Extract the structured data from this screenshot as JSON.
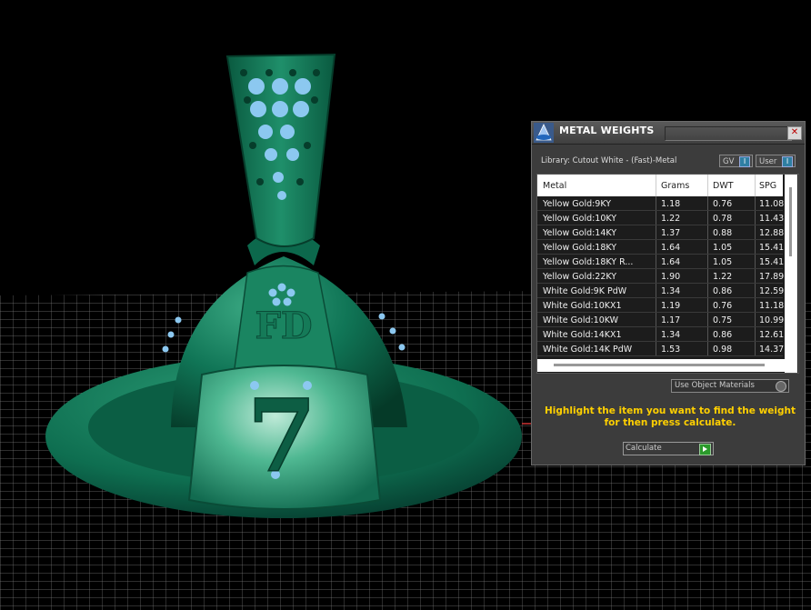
{
  "panel": {
    "title": "METAL WEIGHTS",
    "close_glyph": "✕",
    "library_label": "Library: Cutout White - (Fast)-Metal",
    "gv_toggle": "GV",
    "user_toggle": "User",
    "toggle_indicator": "I",
    "columns": [
      "Metal",
      "Grams",
      "DWT",
      "SPG"
    ],
    "rows": [
      {
        "metal": "Yellow Gold:9KY",
        "grams": "1.18",
        "dwt": "0.76",
        "spg": "11.08"
      },
      {
        "metal": "Yellow Gold:10KY",
        "grams": "1.22",
        "dwt": "0.78",
        "spg": "11.43"
      },
      {
        "metal": "Yellow Gold:14KY",
        "grams": "1.37",
        "dwt": "0.88",
        "spg": "12.88"
      },
      {
        "metal": "Yellow Gold:18KY",
        "grams": "1.64",
        "dwt": "1.05",
        "spg": "15.41"
      },
      {
        "metal": "Yellow Gold:18KY R...",
        "grams": "1.64",
        "dwt": "1.05",
        "spg": "15.41"
      },
      {
        "metal": "Yellow Gold:22KY",
        "grams": "1.90",
        "dwt": "1.22",
        "spg": "17.89"
      },
      {
        "metal": "White Gold:9K PdW",
        "grams": "1.34",
        "dwt": "0.86",
        "spg": "12.59"
      },
      {
        "metal": "White Gold:10KX1",
        "grams": "1.19",
        "dwt": "0.76",
        "spg": "11.18"
      },
      {
        "metal": "White Gold:10KW",
        "grams": "1.17",
        "dwt": "0.75",
        "spg": "10.99"
      },
      {
        "metal": "White Gold:14KX1",
        "grams": "1.34",
        "dwt": "0.86",
        "spg": "12.61"
      },
      {
        "metal": "White Gold:14K PdW",
        "grams": "1.53",
        "dwt": "0.98",
        "spg": "14.37"
      }
    ],
    "use_object_materials": "Use Object Materials",
    "hint": "Highlight the item you want to find the weight for then press calculate.",
    "calculate": "Calculate"
  },
  "viewport": {
    "pendant_engraving": "7",
    "pendant_initials": "FD",
    "model_color": "#0f7a58",
    "grid_color": "#7a7a7a"
  }
}
